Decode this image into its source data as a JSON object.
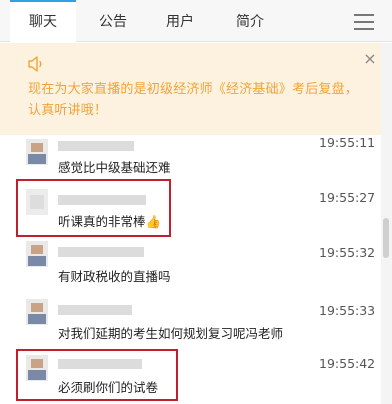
{
  "tabs": [
    {
      "label": "聊天",
      "active": true
    },
    {
      "label": "公告",
      "active": false
    },
    {
      "label": "用户",
      "active": false
    },
    {
      "label": "简介",
      "active": false
    }
  ],
  "menu_icon": "hamburger-icon",
  "notice": {
    "icon": "speaker-icon",
    "text": "现在为大家直播的是初级经济师《经济基础》考后复盘，认真听讲哦！",
    "close_label": "×",
    "color": "#f0a437",
    "background": "#fdf2e0"
  },
  "messages": [
    {
      "time": "19:55:11",
      "text": "感觉比中级基础还难",
      "highlighted": false
    },
    {
      "time": "19:55:27",
      "text": "听课真的非常棒👍",
      "highlighted": true
    },
    {
      "time": "19:55:32",
      "text": "有财政税收的直播吗",
      "highlighted": false
    },
    {
      "time": "19:55:33",
      "text": "对我们延期的考生如何规划复习呢冯老师",
      "highlighted": false
    },
    {
      "time": "19:55:42",
      "text": "必须刷你们的试卷",
      "highlighted": true
    }
  ],
  "colors": {
    "tab_accent": "#2ea2e6",
    "highlight_border": "#c0202e"
  }
}
